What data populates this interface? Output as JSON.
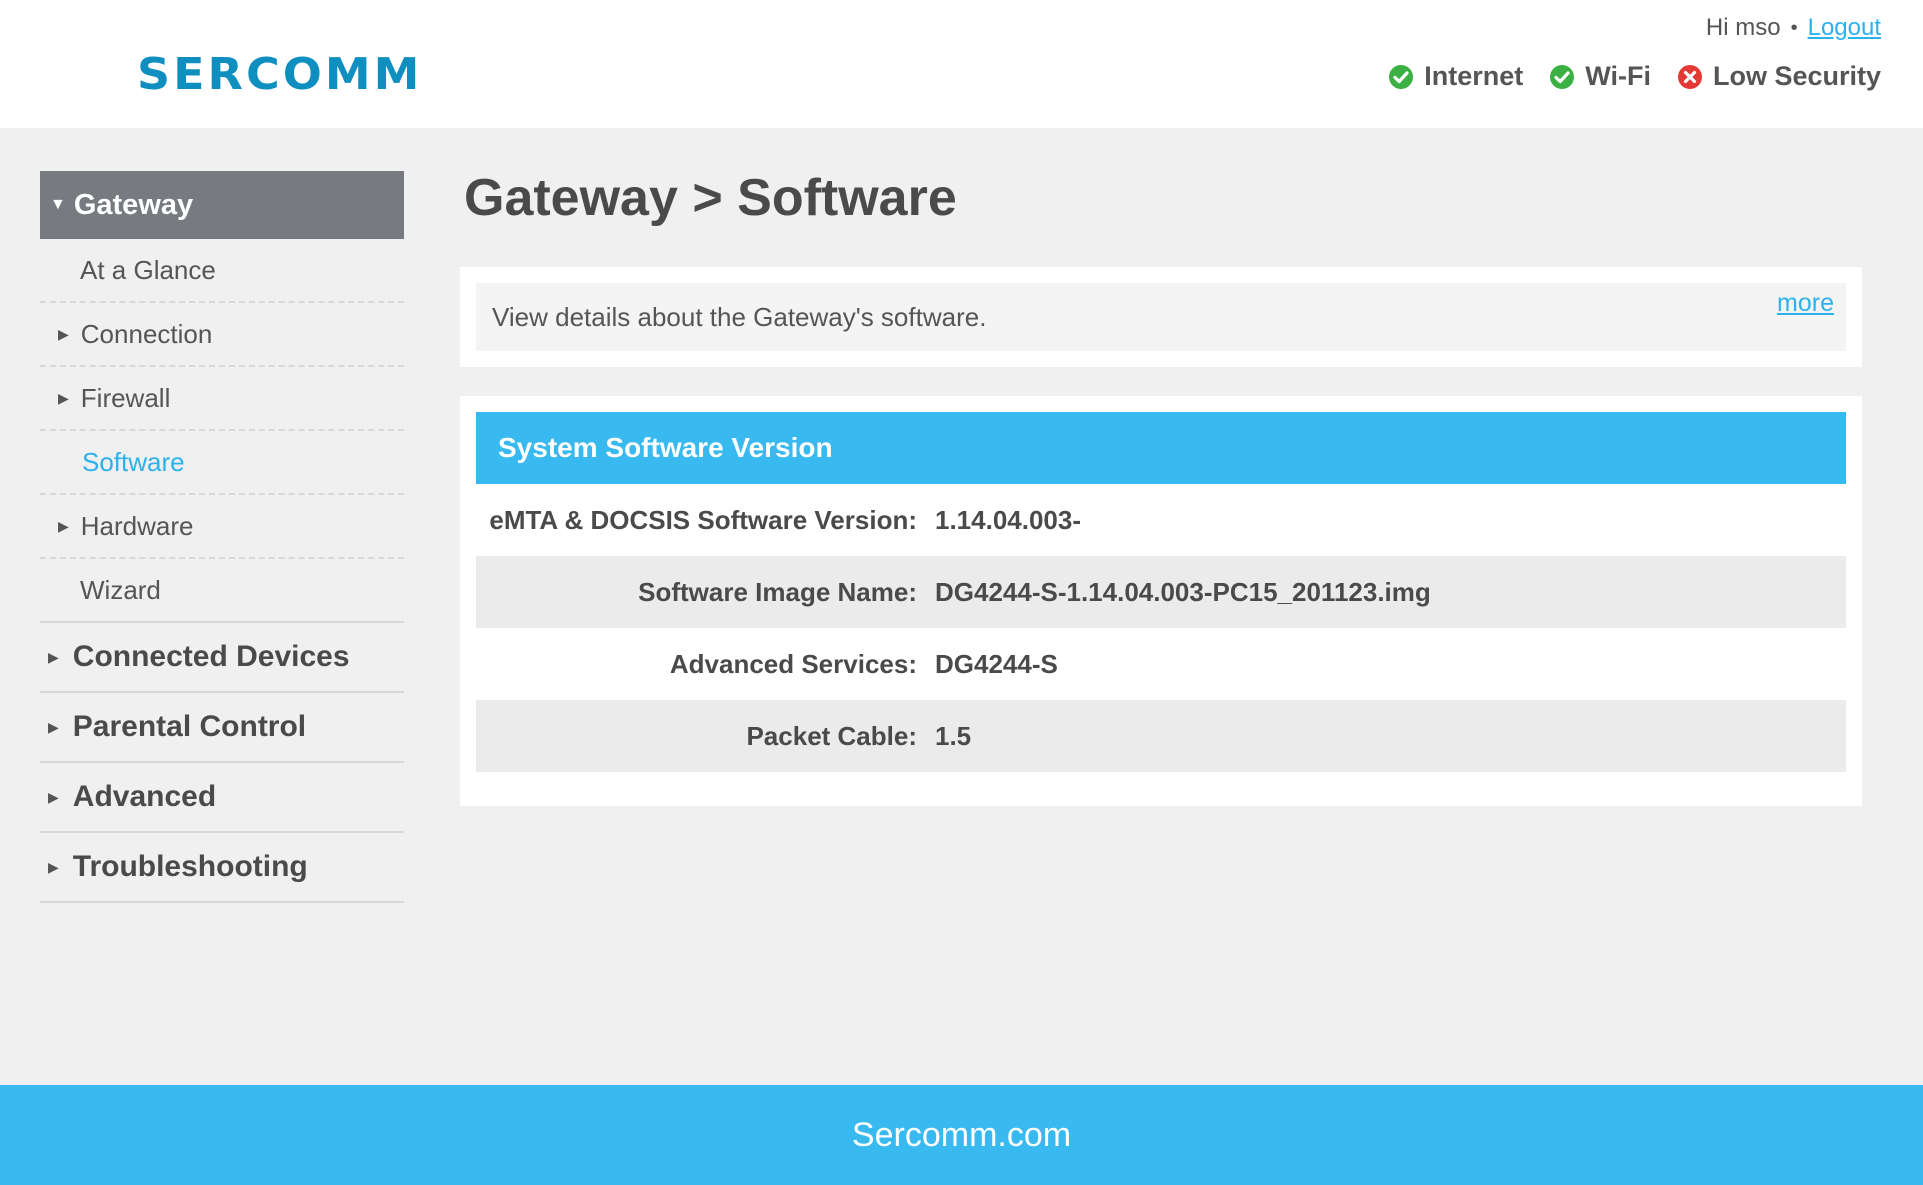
{
  "header": {
    "logo_text": "SERCOMM",
    "greeting": "Hi mso",
    "separator": "•",
    "logout_label": "Logout",
    "status": [
      {
        "label": "Internet",
        "state": "ok",
        "color": "#3cb043"
      },
      {
        "label": "Wi-Fi",
        "state": "ok",
        "color": "#3cb043"
      },
      {
        "label": "Low Security",
        "state": "error",
        "color": "#e53935"
      }
    ]
  },
  "sidebar": {
    "section_title": "Gateway",
    "sub_items": [
      {
        "label": "At a Glance",
        "arrow": false,
        "active": false
      },
      {
        "label": "Connection",
        "arrow": true,
        "active": false
      },
      {
        "label": "Firewall",
        "arrow": true,
        "active": false
      },
      {
        "label": "Software",
        "arrow": false,
        "active": true
      },
      {
        "label": "Hardware",
        "arrow": true,
        "active": false
      },
      {
        "label": "Wizard",
        "arrow": false,
        "active": false
      }
    ],
    "top_items": [
      {
        "label": "Connected Devices"
      },
      {
        "label": "Parental Control"
      },
      {
        "label": "Advanced"
      },
      {
        "label": "Troubleshooting"
      }
    ]
  },
  "main": {
    "title": "Gateway > Software",
    "info_text": "View details about the Gateway's software.",
    "more_label": "more",
    "module_title": "System Software Version",
    "rows": [
      {
        "label": "eMTA & DOCSIS Software Version:",
        "value": "1.14.04.003-"
      },
      {
        "label": "Software Image Name:",
        "value": "DG4244-S-1.14.04.003-PC15_201123.img"
      },
      {
        "label": "Advanced Services:",
        "value": "DG4244-S"
      },
      {
        "label": "Packet Cable:",
        "value": "1.5"
      }
    ]
  },
  "footer": {
    "text": "Sercomm.com"
  },
  "colors": {
    "accent": "#38b9ef",
    "link": "#2bb2ec",
    "logo": "#0f8fc0",
    "nav_header": "#777b80"
  }
}
